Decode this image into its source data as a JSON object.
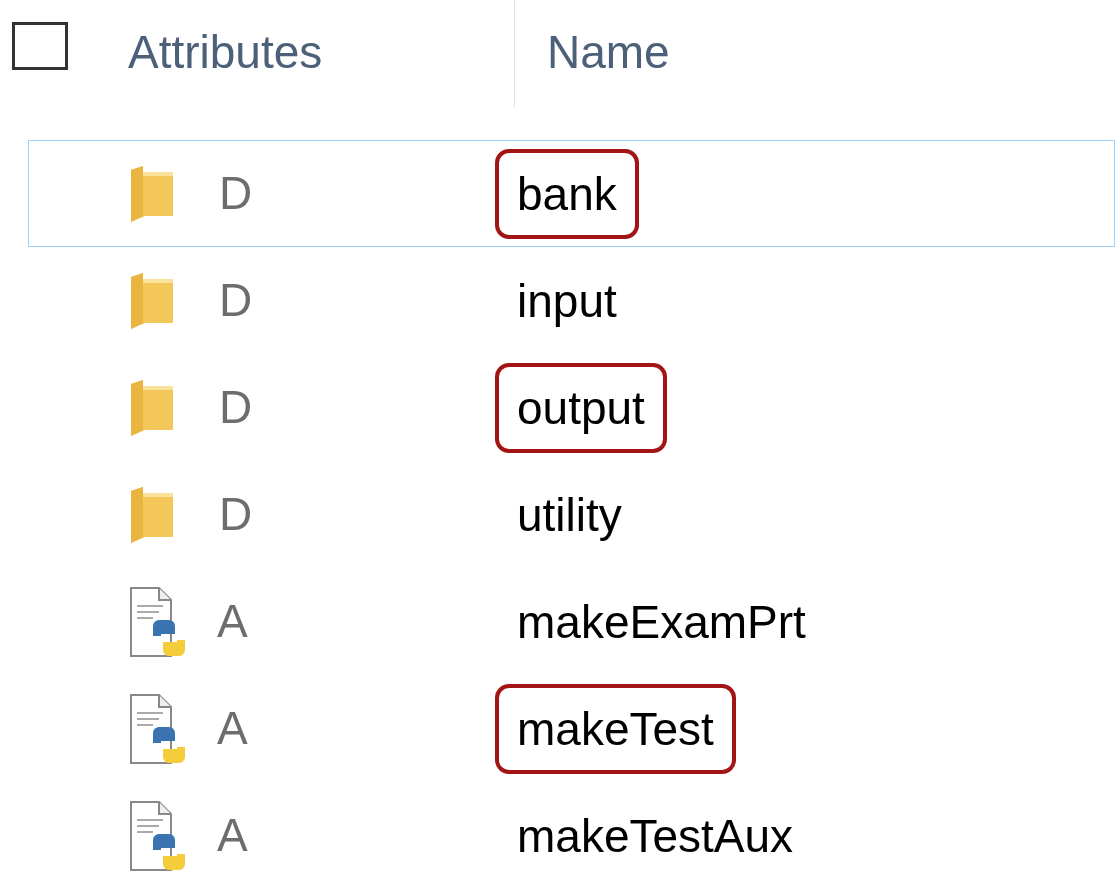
{
  "header": {
    "select_all_checked": false,
    "columns": [
      "Attributes",
      "Name"
    ]
  },
  "rows": [
    {
      "kind": "folder",
      "attributes": "D",
      "name": "bank",
      "selected": true,
      "highlighted": true
    },
    {
      "kind": "folder",
      "attributes": "D",
      "name": "input",
      "selected": false,
      "highlighted": false
    },
    {
      "kind": "folder",
      "attributes": "D",
      "name": "output",
      "selected": false,
      "highlighted": true
    },
    {
      "kind": "folder",
      "attributes": "D",
      "name": "utility",
      "selected": false,
      "highlighted": false
    },
    {
      "kind": "python",
      "attributes": "A",
      "name": "makeExamPrt",
      "selected": false,
      "highlighted": false
    },
    {
      "kind": "python",
      "attributes": "A",
      "name": "makeTest",
      "selected": false,
      "highlighted": true
    },
    {
      "kind": "python",
      "attributes": "A",
      "name": "makeTestAux",
      "selected": false,
      "highlighted": false
    }
  ]
}
